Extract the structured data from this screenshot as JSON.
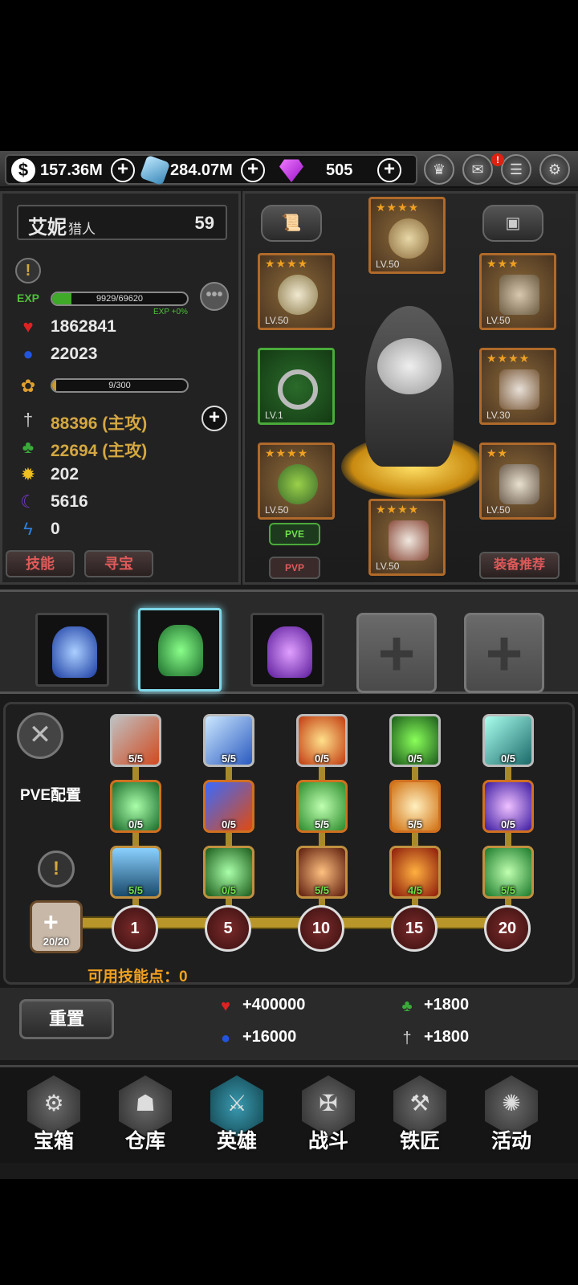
{
  "currency": {
    "coins": "157.36M",
    "crystals": "284.07M",
    "gems": "505",
    "coin_symbol": "$"
  },
  "top_icons": [
    "trophy-icon",
    "mail-icon",
    "chat-icon",
    "gear-icon"
  ],
  "chat_alert": "!",
  "hero": {
    "name": "艾妮",
    "class": "猎人",
    "level": "59",
    "exp_label": "EXP",
    "exp_text": "9929/69620",
    "exp_fraction": 0.143,
    "exp_bonus": "EXP +0%",
    "hp": "1862841",
    "mp": "22023",
    "pet_text": "9/300",
    "pet_fraction": 0.03,
    "attack": "88396 (主攻)",
    "magic_attack": "22694 (主攻)",
    "crit": "202",
    "dodge": "5616",
    "speed": "0",
    "skill_button": "技能",
    "treasure_button": "寻宝"
  },
  "equipment": {
    "slots": [
      {
        "stars": "★★★★",
        "level": "LV.50"
      },
      {
        "stars": "★★★★",
        "level": "LV.50"
      },
      {
        "stars": "★★★",
        "level": "LV.50"
      },
      {
        "stars": "",
        "level": "LV.1"
      },
      {
        "stars": "★★★★",
        "level": "LV.30"
      },
      {
        "stars": "★★★★",
        "level": "LV.50"
      },
      {
        "stars": "★★",
        "level": "LV.50"
      },
      {
        "stars": "★★★★",
        "level": "LV.50"
      }
    ],
    "pve_tab": "PVE",
    "pvp_tab": "PVP",
    "recommend_button": "装备推荐"
  },
  "skills": {
    "config_label": "PVE配置",
    "rows": [
      [
        "5/5",
        "5/5",
        "0/5",
        "0/5",
        "0/5"
      ],
      [
        "0/5",
        "0/5",
        "5/5",
        "5/5",
        "0/5"
      ],
      [
        "5/5",
        "0/5",
        "5/5",
        "4/5",
        "5/5"
      ]
    ],
    "tiers": [
      "1",
      "5",
      "10",
      "15",
      "20"
    ],
    "points_total": "20/20",
    "available_points": "可用技能点：0"
  },
  "bonuses": {
    "reset_button": "重置",
    "hp": "+400000",
    "mp": "+16000",
    "magic": "+1800",
    "attack": "+1800"
  },
  "nav": [
    "宝箱",
    "仓库",
    "英雄",
    "战斗",
    "铁匠",
    "活动"
  ],
  "colors": {
    "gold_text": "#d4a840",
    "exp_green": "#4fbf3a",
    "accent_cyan": "#7fd8ea",
    "red_button_text": "#e05a5a"
  }
}
